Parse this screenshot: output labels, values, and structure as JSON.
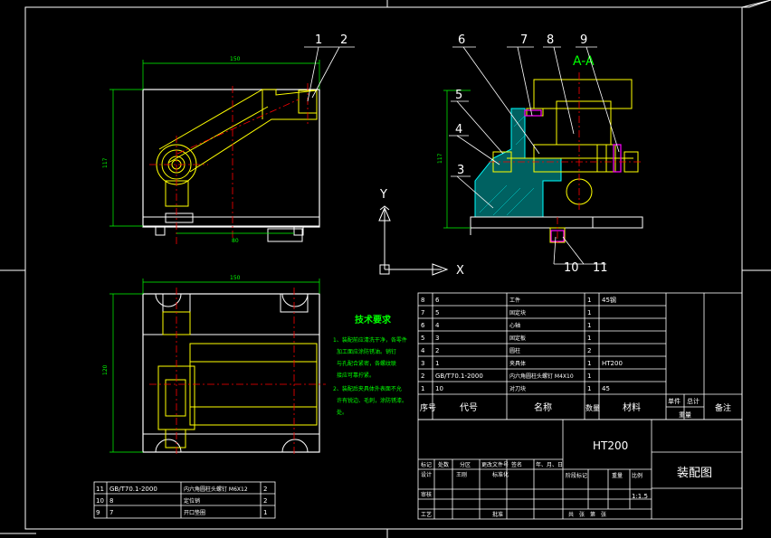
{
  "colors": {
    "background": "#000000",
    "frame": "#ffffff",
    "part": "#ffff00",
    "section": "#00ffff",
    "center": "#ff0000",
    "dimension": "#00ff00",
    "hatch": "#00ffff",
    "text": "#ffffff"
  },
  "dimensions": {
    "top_width": "150",
    "left_height": "117",
    "bottom_width": "80",
    "plan_width": "150",
    "plan_height": "120",
    "section_height": "117"
  },
  "balloons": {
    "b1": "1",
    "b2": "2",
    "b3": "3",
    "b4": "4",
    "b5": "5",
    "b6": "6",
    "b7": "7",
    "b8": "8",
    "b9": "9",
    "b10": "10",
    "b11": "11"
  },
  "section_label": "A-A",
  "axes": {
    "y": "Y",
    "x": "X"
  },
  "tech": {
    "title": "技术要求",
    "line1": "1、装配前应清洗干净，各零件",
    "line2": "加工面应涂防锈油。销钉",
    "line3": "与孔配合紧密，各螺纹联",
    "line4": "接应可靠拧紧。",
    "line5": "2、装配后夹具体外表面不允",
    "line6": "许有锐边、毛刺，涂防锈漆。",
    "line7": "处。"
  },
  "bom": {
    "rows": [
      {
        "no": "8",
        "code": "6",
        "name": "工件",
        "qty": "1",
        "mat": "45钢"
      },
      {
        "no": "7",
        "code": "5",
        "name": "固定块",
        "qty": "1",
        "mat": ""
      },
      {
        "no": "6",
        "code": "4",
        "name": "心轴",
        "qty": "1",
        "mat": ""
      },
      {
        "no": "5",
        "code": "3",
        "name": "固定板",
        "qty": "1",
        "mat": ""
      },
      {
        "no": "4",
        "code": "2",
        "name": "圆柱",
        "qty": "2",
        "mat": ""
      },
      {
        "no": "3",
        "code": "1",
        "name": "夹具体",
        "qty": "1",
        "mat": "HT200"
      },
      {
        "no": "2",
        "code": "GB/T70.1-2000",
        "name": "内六角圆柱头螺钉 M4X10",
        "qty": "1",
        "mat": ""
      },
      {
        "no": "1",
        "code": "10",
        "name": "对刀块",
        "qty": "1",
        "mat": "45"
      }
    ],
    "header": {
      "no": "序号",
      "code": "代号",
      "name": "名称",
      "qty": "数量",
      "mat": "材料",
      "single": "单件",
      "total": "总计",
      "weight": "重量",
      "note": "备注"
    }
  },
  "bom_lower": {
    "rows": [
      {
        "no": "11",
        "code": "GB/T70.1-2000",
        "name": "内六角圆柱头螺钉 M6X12",
        "qty": "2"
      },
      {
        "no": "10",
        "code": "8",
        "name": "定位销",
        "qty": "2"
      },
      {
        "no": "9",
        "code": "7",
        "name": "开口垫圈",
        "qty": "1"
      }
    ]
  },
  "title_block": {
    "material": "HT200",
    "drawing": "装配图",
    "scale": "1:1.5",
    "mark": "标记",
    "count": "处数",
    "zone": "分区",
    "docno": "更改文件号",
    "sign": "签名",
    "date": "年、月、日",
    "design": "设计",
    "designer": "王刚",
    "std": "标准化",
    "stage": "阶段标记",
    "weight": "重量",
    "ratio": "比例",
    "check": "审核",
    "process": "工艺",
    "approve": "批准",
    "sheet": "共　张　第　张"
  }
}
